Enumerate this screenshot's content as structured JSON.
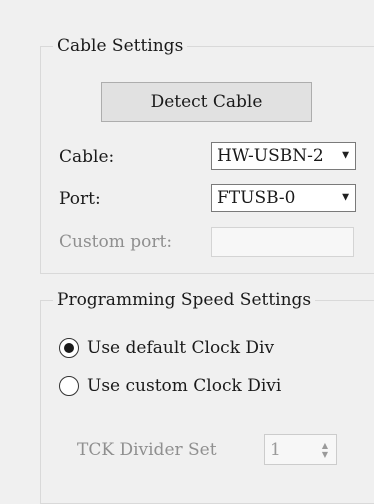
{
  "cable_settings": {
    "title": "Cable Settings",
    "detect_button": "Detect Cable",
    "cable_label": "Cable:",
    "cable_value": "HW-USBN-2",
    "port_label": "Port:",
    "port_value": "FTUSB-0",
    "custom_port_label": "Custom port:",
    "custom_port_value": ""
  },
  "speed_settings": {
    "title": "Programming Speed Settings",
    "default_clock_option": "Use default Clock Div",
    "default_clock_selected": true,
    "custom_clock_option": "Use custom Clock Divi",
    "custom_clock_selected": false,
    "tck_divider_label": "TCK Divider Set",
    "tck_divider_value": "1"
  },
  "icons": {
    "dropdown": "chevron-down-icon",
    "spin": "spin-arrows-icon"
  }
}
